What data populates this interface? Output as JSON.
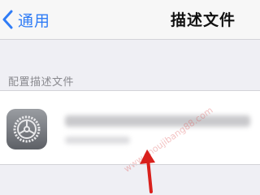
{
  "navbar": {
    "back_label": "通用",
    "title": "描述文件"
  },
  "section": {
    "header": "配置描述文件"
  },
  "profile_row": {
    "icon": "settings-gear-icon",
    "name_redacted": true
  },
  "colors": {
    "accent": "#2f7cf6",
    "annotation_arrow": "#d9201c"
  },
  "annotations": [
    {
      "type": "arrow",
      "points_to": "profile-row"
    }
  ]
}
